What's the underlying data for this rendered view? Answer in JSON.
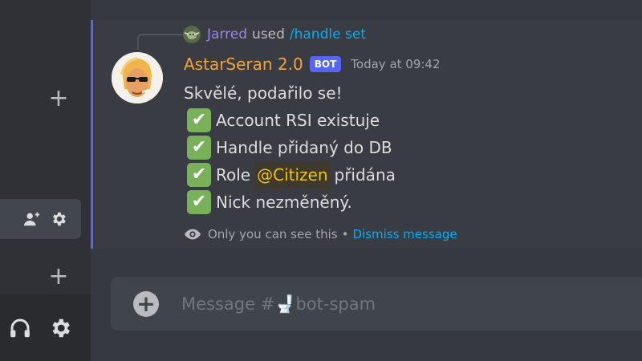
{
  "sidebar": {
    "add_label": "+",
    "add_label_2": "+"
  },
  "message": {
    "reply": {
      "user": "Jarred",
      "used": "used",
      "command": "/handle set"
    },
    "author": "AstarSeran 2.0",
    "bot_tag": "BOT",
    "timestamp": "Today at 09:42",
    "lines": [
      "Skvělé, podařilo se!",
      "Account RSI existuje",
      "Handle přidaný do DB",
      "Role",
      "přidána",
      "Nick nezměněný."
    ],
    "check_emoji": "✔",
    "role_mention": "@Citizen",
    "ephemeral_note": "Only you can see this",
    "separator": "•",
    "dismiss": "Dismiss message"
  },
  "composer": {
    "attach_label": "+",
    "placeholder": "Message #🚽bot-spam"
  },
  "colors": {
    "accent": "#5865f2",
    "author": "#f0a33a",
    "link": "#00aff4",
    "mention": "#f1c40f",
    "replied_user": "#9b84ec",
    "check": "#78b159"
  },
  "icons": [
    "add-icon",
    "add-member-icon",
    "settings-icon",
    "headphones-icon",
    "eye-icon",
    "avatar",
    "add-attachment-icon"
  ]
}
